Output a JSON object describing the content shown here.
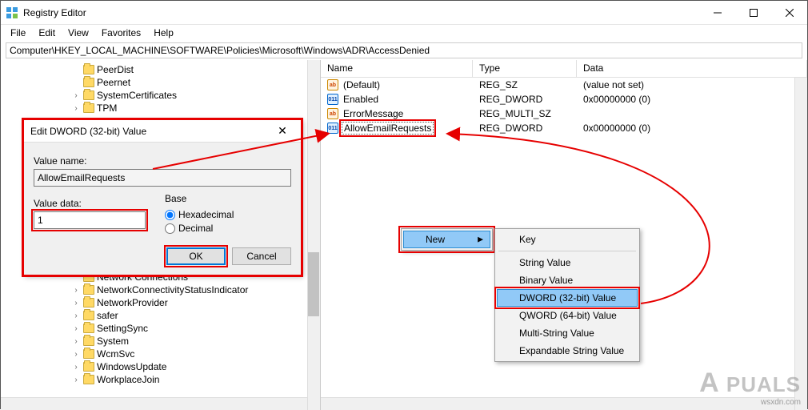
{
  "window": {
    "title": "Registry Editor",
    "path": "Computer\\HKEY_LOCAL_MACHINE\\SOFTWARE\\Policies\\Microsoft\\Windows\\ADR\\AccessDenied"
  },
  "menubar": {
    "file": "File",
    "edit": "Edit",
    "view": "View",
    "favorites": "Favorites",
    "help": "Help"
  },
  "tree": {
    "items_top": [
      "PeerDist",
      "Peernet",
      "SystemCertificates",
      "TPM"
    ],
    "items_bottom": [
      "Network Connections",
      "NetworkConnectivityStatusIndicator",
      "NetworkProvider",
      "safer",
      "SettingSync",
      "System",
      "WcmSvc",
      "WindowsUpdate",
      "WorkplaceJoin"
    ]
  },
  "list": {
    "headers": {
      "name": "Name",
      "type": "Type",
      "data": "Data"
    },
    "rows": [
      {
        "icon": "ab",
        "name": "(Default)",
        "type": "REG_SZ",
        "data": "(value not set)"
      },
      {
        "icon": "bin",
        "name": "Enabled",
        "type": "REG_DWORD",
        "data": "0x00000000 (0)"
      },
      {
        "icon": "ab",
        "name": "ErrorMessage",
        "type": "REG_MULTI_SZ",
        "data": ""
      },
      {
        "icon": "bin",
        "name": "AllowEmailRequests",
        "type": "REG_DWORD",
        "data": "0x00000000 (0)",
        "selected": true
      }
    ]
  },
  "dialog": {
    "title": "Edit DWORD (32-bit) Value",
    "value_name_label": "Value name:",
    "value_name": "AllowEmailRequests",
    "value_data_label": "Value data:",
    "value_data": "1",
    "base_label": "Base",
    "hex": "Hexadecimal",
    "dec": "Decimal",
    "ok": "OK",
    "cancel": "Cancel"
  },
  "context_new": {
    "label": "New",
    "submenu": [
      "Key",
      "String Value",
      "Binary Value",
      "DWORD (32-bit) Value",
      "QWORD (64-bit) Value",
      "Multi-String Value",
      "Expandable String Value"
    ],
    "highlighted_index": 3
  },
  "watermark": "A PUALS",
  "credit": "wsxdn.com"
}
